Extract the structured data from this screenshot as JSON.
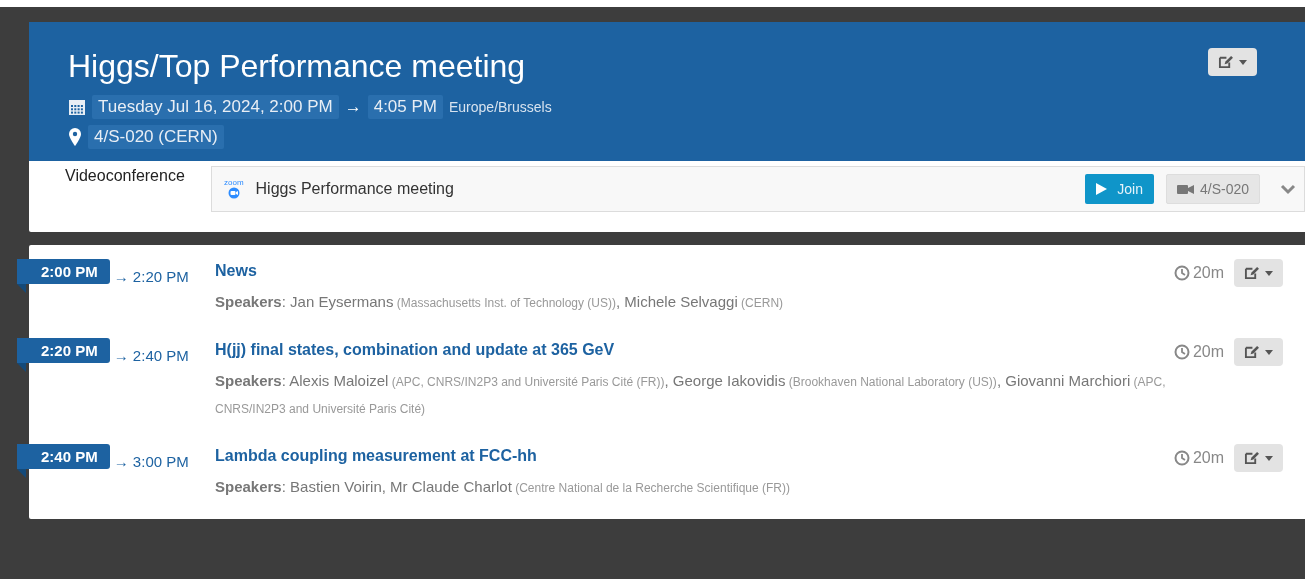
{
  "event": {
    "title": "Higgs/Top Performance meeting",
    "start": "Tuesday Jul 16, 2024, 2:00 PM",
    "arrow": "→",
    "end": "4:05 PM",
    "timezone": "Europe/Brussels",
    "location": "4/S-020 (CERN)"
  },
  "videoconference": {
    "label": "Videoconference",
    "service_logo": "zoom",
    "room_name": "Higgs Performance meeting",
    "join": "Join",
    "room": "4/S-020"
  },
  "contributions": [
    {
      "start": "2:00 PM",
      "end": "→ 2:20 PM",
      "title": "News",
      "duration": "20m",
      "speakers": [
        {
          "kind": "label",
          "text": "Speakers"
        },
        {
          "kind": "plain",
          "text": ": "
        },
        {
          "kind": "name",
          "text": "Jan Eysermans"
        },
        {
          "kind": "affiliation",
          "text": "(Massachusetts Inst. of Technology (US))"
        },
        {
          "kind": "plain",
          "text": ", "
        },
        {
          "kind": "name",
          "text": "Michele Selvaggi"
        },
        {
          "kind": "affiliation",
          "text": "(CERN)"
        }
      ]
    },
    {
      "start": "2:20 PM",
      "end": "→ 2:40 PM",
      "title": "H(jj) final states, combination and update at 365 GeV",
      "duration": "20m",
      "speakers": [
        {
          "kind": "label",
          "text": "Speakers"
        },
        {
          "kind": "plain",
          "text": ": "
        },
        {
          "kind": "name",
          "text": "Alexis Maloizel"
        },
        {
          "kind": "affiliation",
          "text": "(APC, CNRS/IN2P3 and Université Paris Cité (FR))"
        },
        {
          "kind": "plain",
          "text": ", "
        },
        {
          "kind": "name",
          "text": "George Iakovidis"
        },
        {
          "kind": "affiliation",
          "text": "(Brookhaven National Laboratory (US))"
        },
        {
          "kind": "plain",
          "text": ", "
        },
        {
          "kind": "name",
          "text": "Giovanni Marchiori"
        },
        {
          "kind": "affiliation",
          "text": "(APC, CNRS/IN2P3 and Université Paris Cité)"
        }
      ]
    },
    {
      "start": "2:40 PM",
      "end": "→ 3:00 PM",
      "title": "Lambda coupling measurement at FCC-hh",
      "duration": "20m",
      "speakers": [
        {
          "kind": "label",
          "text": "Speakers"
        },
        {
          "kind": "plain",
          "text": ": "
        },
        {
          "kind": "name",
          "text": "Bastien Voirin, Mr Claude Charlot"
        },
        {
          "kind": "affiliation",
          "text": "(Centre National de la Recherche Scientifique (FR))"
        }
      ]
    }
  ]
}
